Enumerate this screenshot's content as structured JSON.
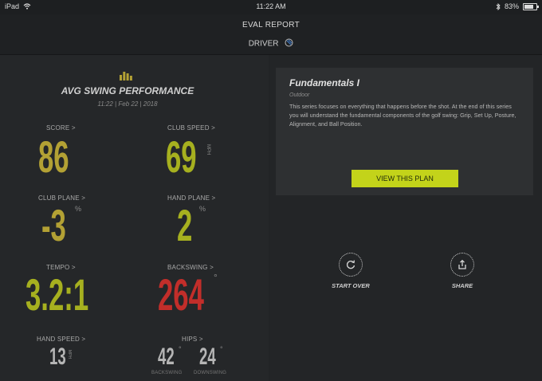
{
  "status_bar": {
    "device": "iPad",
    "time": "11:22 AM",
    "battery": "83%",
    "battery_level": 0.83
  },
  "header": {
    "title": "EVAL REPORT",
    "club": "DRIVER",
    "club_icon": "golf-ball-icon"
  },
  "performance": {
    "icon": "bar-chart-icon",
    "title": "AVG SWING PERFORMANCE",
    "date": "11:22 | Feb 22 | 2018",
    "metrics": {
      "score": {
        "label": "SCORE >",
        "value": "86",
        "color": "#b3a134"
      },
      "club_speed": {
        "label": "CLUB SPEED >",
        "value": "69",
        "unit": "MPH",
        "color": "#a6b01f"
      },
      "club_plane": {
        "label": "CLUB PLANE >",
        "value": "-3",
        "unit": "%",
        "color": "#b3a134"
      },
      "hand_plane": {
        "label": "HAND PLANE >",
        "value": "2",
        "unit": "%",
        "color": "#a6b01f"
      },
      "tempo": {
        "label": "TEMPO >",
        "value": "3.2:1",
        "color": "#a6b01f"
      },
      "backswing": {
        "label": "BACKSWING >",
        "value": "264",
        "unit": "°",
        "color": "#c22e2a"
      },
      "hand_speed": {
        "label": "HAND SPEED >",
        "value": "13",
        "unit": "MPH",
        "color": "#b5b5b5"
      },
      "hips": {
        "label": "HIPS >",
        "backswing_value": "42",
        "backswing_unit": "°",
        "backswing_label": "BACKSWING",
        "downswing_value": "24",
        "downswing_unit": "°",
        "downswing_label": "DOWNSWING",
        "color": "#b5b5b5"
      }
    }
  },
  "plan_card": {
    "title": "Fundamentals I",
    "subtitle": "Outdoor",
    "description": "This series focuses on everything that happens before the shot. At the end of this series you will understand the fundamental components of the golf swing: Grip, Set Up, Posture, Alignment, and Ball Position.",
    "button": "VIEW THIS PLAN",
    "button_color": "#c3d31a"
  },
  "actions": {
    "start_over": {
      "label": "START OVER",
      "icon": "restart-icon"
    },
    "share": {
      "label": "SHARE",
      "icon": "share-icon"
    }
  }
}
